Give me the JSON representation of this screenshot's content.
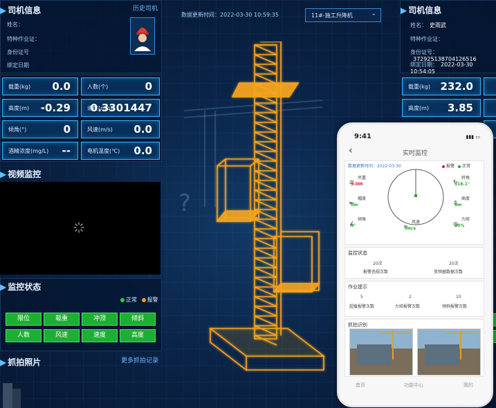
{
  "header": {
    "update_time_label": "数据更新时间：2022-03-30 10:59:35",
    "device_select": "11#-施工升降机"
  },
  "left": {
    "driver_info": {
      "title": "司机信息",
      "history_link": "历史司机",
      "name_label": "姓名：",
      "cert_label": "特种作业证：",
      "id_label": "身份证号",
      "bind_date_label": "绑定日期"
    },
    "metrics": [
      {
        "label": "载重(kg)",
        "value": "0.0"
      },
      {
        "label": "人数(个)",
        "value": "0"
      },
      {
        "label": "高度(m)",
        "value": "-0.29"
      },
      {
        "label": "速度(m/s)",
        "value": "0.3301447"
      },
      {
        "label": "倾角(°)",
        "value": "0"
      },
      {
        "label": "风速(m/s)",
        "value": "0.0"
      },
      {
        "label": "酒精浓度(mg/L)",
        "value": "--"
      },
      {
        "label": "电机温度(℃)",
        "value": "0.0"
      }
    ],
    "video": {
      "title": "视频监控"
    },
    "monitor": {
      "title": "监控状态",
      "legend_normal": "正常",
      "legend_alarm": "报警",
      "buttons": [
        "限位",
        "载重",
        "冲顶",
        "倾斜",
        "人数",
        "风速",
        "速度",
        "高度"
      ]
    },
    "capture": {
      "title": "抓拍照片",
      "link": "更多抓拍记录"
    }
  },
  "right": {
    "driver_info": {
      "title": "司机信息",
      "name_label": "姓名：",
      "name_value": "史雨武",
      "cert_label": "特种作业证：",
      "id_label": "身份证号：",
      "id_value": "372925138704126516",
      "bind_date_label": "绑定日期：",
      "bind_date_value": "2022-03-30 10:54:05"
    },
    "metrics": [
      {
        "label": "载重(kg)",
        "value": "232.0"
      },
      {
        "label": "高度(m)",
        "value": "3.85"
      }
    ]
  },
  "phone": {
    "status_time": "9:41",
    "title": "实时监控",
    "update_time": "数据更新时间：2022-03-30",
    "legend_alarm": "报警",
    "legend_normal": "正常",
    "readings": [
      {
        "label": "吊重",
        "value": "5.00t",
        "color": "#d32020"
      },
      {
        "label": "转角",
        "value": "116.1°",
        "color": "#2aa52a"
      },
      {
        "label": "幅度",
        "value": "0m",
        "color": "#2aa52a"
      },
      {
        "label": "高度",
        "value": "0m",
        "color": "#2aa52a"
      },
      {
        "label": "倾角",
        "value": "0°",
        "color": "#2aa52a"
      },
      {
        "label": "风速",
        "value": "0m/s",
        "color": "#2aa52a"
      },
      {
        "label": "力矩",
        "value": "20%",
        "color": "#2aa52a"
      }
    ],
    "monitor_section": {
      "title": "监控状态",
      "items": [
        {
          "value": "20次",
          "label": "报警违规次数"
        },
        {
          "value": "20次",
          "label": "变频器数据次数"
        }
      ]
    },
    "work_section": {
      "title": "作业提示",
      "items": [
        {
          "value": "5",
          "label": "超载报警次数"
        },
        {
          "value": "2",
          "label": "力矩报警次数"
        },
        {
          "value": "10",
          "label": "倾斜报警次数"
        }
      ]
    },
    "capture_section": {
      "title": "抓拍识别"
    },
    "bottom_nav": [
      "首页",
      "功能中心",
      "我的"
    ]
  }
}
